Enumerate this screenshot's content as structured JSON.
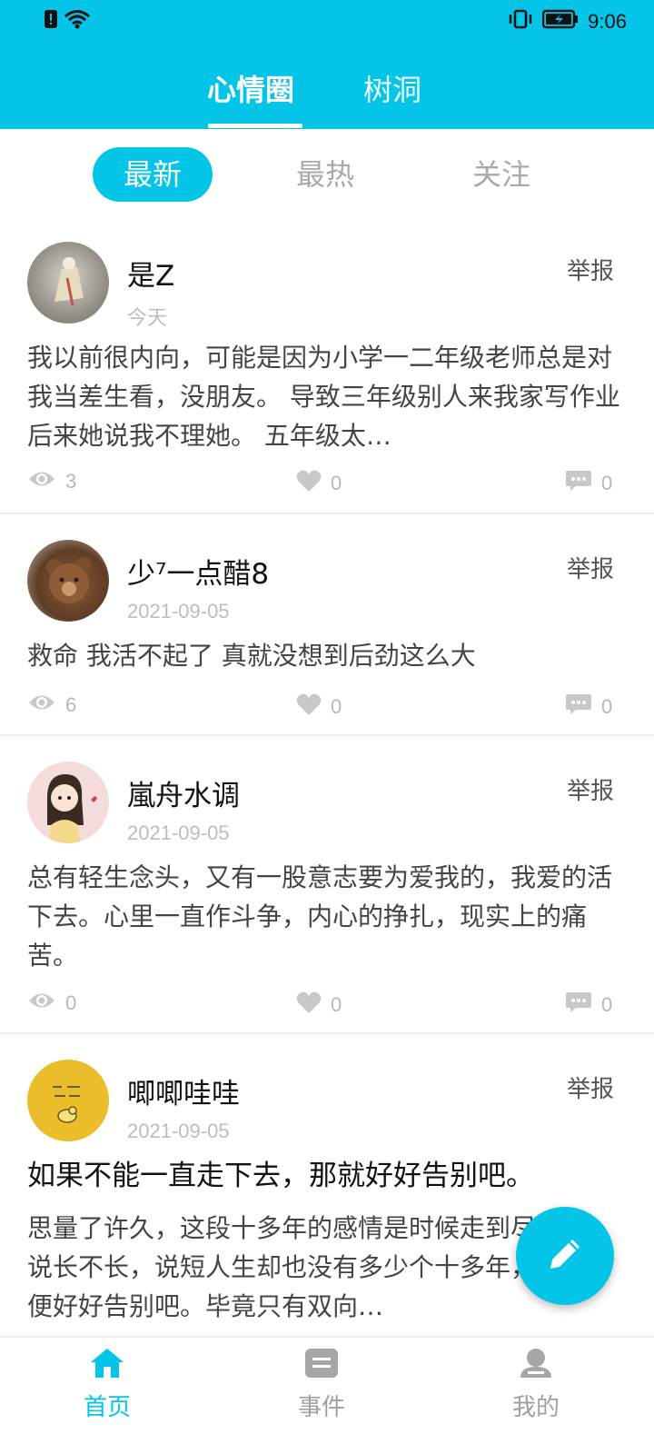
{
  "status_bar": {
    "time": "9:06",
    "icons": [
      "alert-icon",
      "wifi-icon",
      "vibrate-icon",
      "battery-icon"
    ]
  },
  "top_tabs": [
    {
      "label": "心情圈",
      "active": true
    },
    {
      "label": "树洞",
      "active": false
    }
  ],
  "filters": [
    {
      "label": "最新",
      "active": true
    },
    {
      "label": "最热",
      "active": false
    },
    {
      "label": "关注",
      "active": false
    }
  ],
  "report_label": "举报",
  "posts": [
    {
      "user": "是Z",
      "date": "今天",
      "title": "",
      "text": "我以前很内向，可能是因为小学一二年级老师总是对我当差生看，没朋友。 导致三年级别人来我家写作业后来她说我不理她。 五年级太…",
      "views": "3",
      "likes": "0",
      "comments": "0"
    },
    {
      "user": "少⁷一点醋8",
      "date": "2021-09-05",
      "title": "",
      "text": "救命 我活不起了 真就没想到后劲这么大",
      "views": "6",
      "likes": "0",
      "comments": "0"
    },
    {
      "user": "嵐舟水调",
      "date": "2021-09-05",
      "title": "",
      "text": "总有轻生念头，又有一股意志要为爱我的，我爱的活下去。心里一直作斗争，内心的挣扎，现实上的痛苦。",
      "views": "0",
      "likes": "0",
      "comments": "0"
    },
    {
      "user": "唧唧哇哇",
      "date": "2021-09-05",
      "title": "如果不能一直走下去，那就好好告别吧。",
      "text": "思量了许久，这段十多年的感情是时候走到尽头了，说长不长，说短人生却也没有多少个十多年，所以，便好好告别吧。毕竟只有双向…",
      "views": "",
      "likes": "",
      "comments": ""
    }
  ],
  "bottom_nav": [
    {
      "label": "首页",
      "active": true
    },
    {
      "label": "事件",
      "active": false
    },
    {
      "label": "我的",
      "active": false
    }
  ],
  "colors": {
    "accent": "#04c5e8",
    "muted": "#b8b8b8"
  }
}
